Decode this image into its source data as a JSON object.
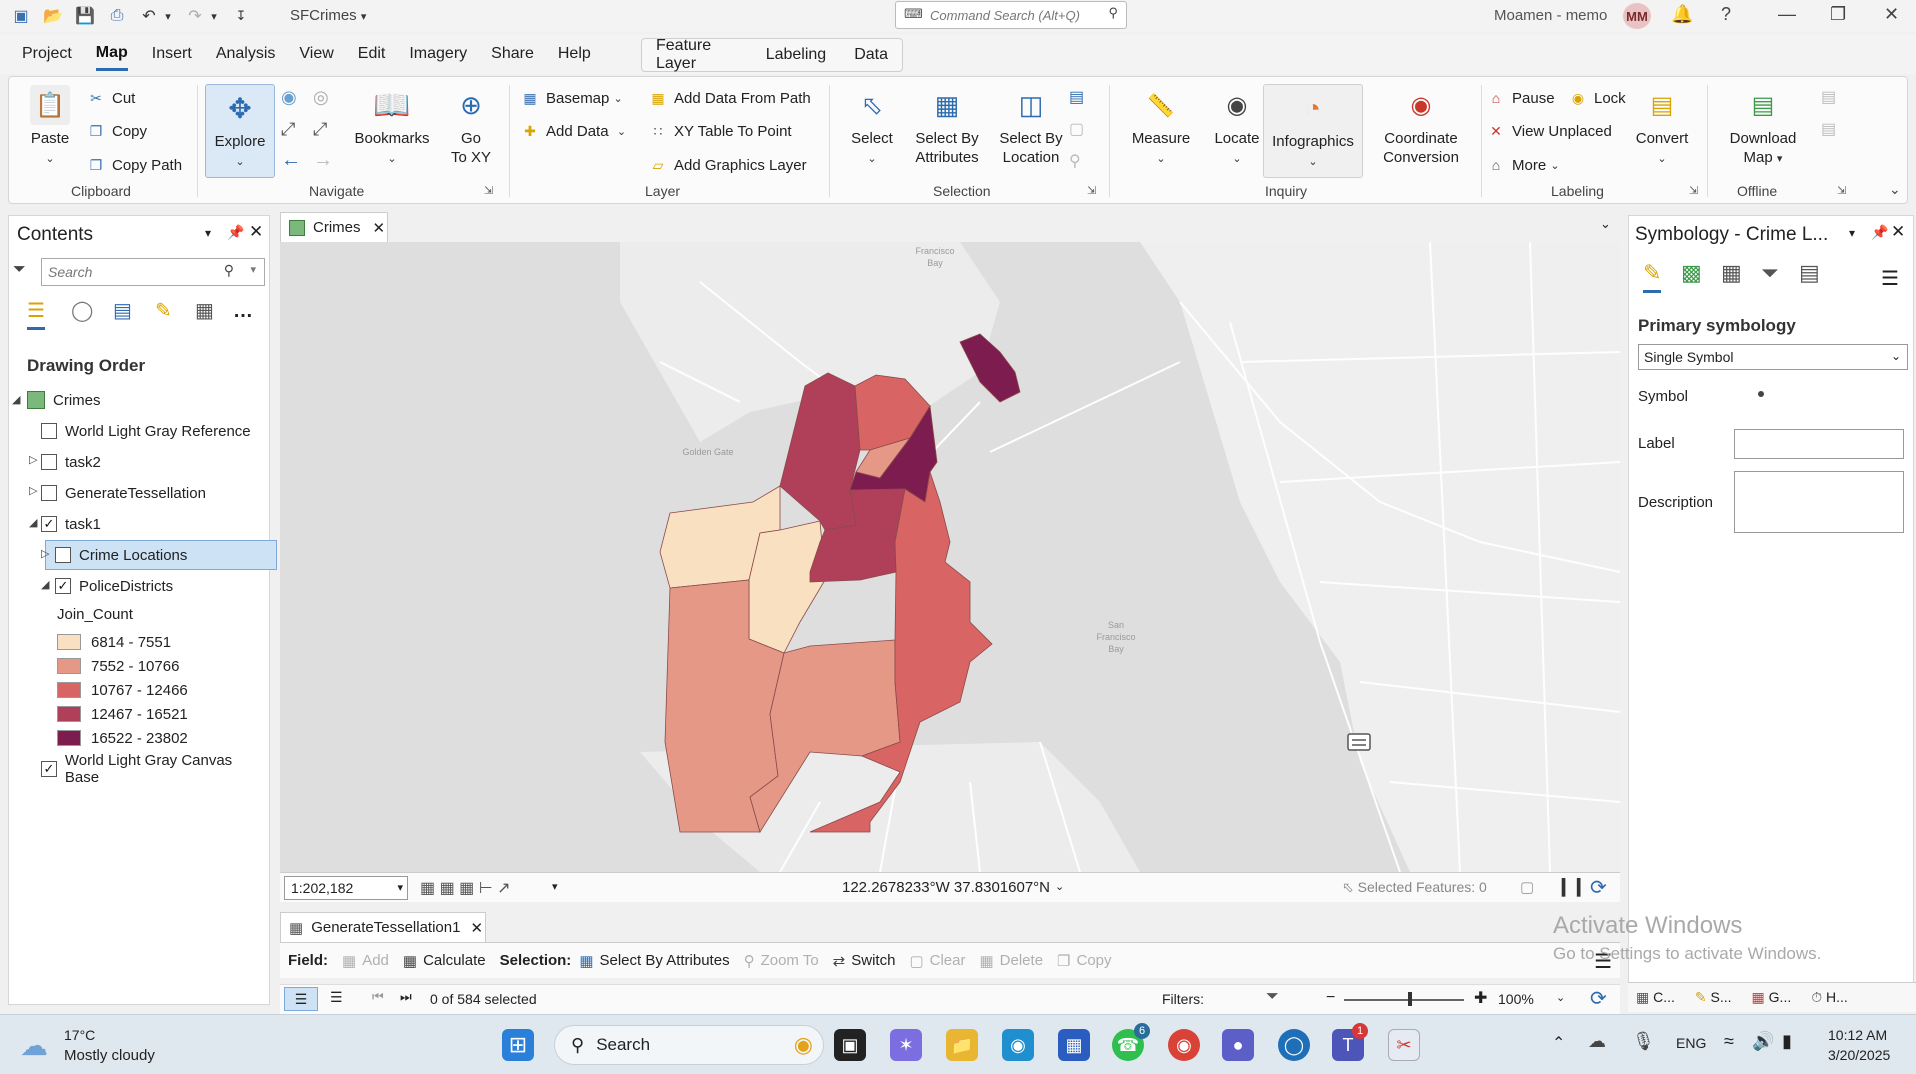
{
  "titlebar": {
    "app_title": "SFCrimes",
    "command_search_placeholder": "Command Search (Alt+Q)",
    "user_name": "Moamen - memo",
    "user_initials": "MM"
  },
  "menu": {
    "items": [
      "Project",
      "Map",
      "Insert",
      "Analysis",
      "View",
      "Edit",
      "Imagery",
      "Share",
      "Help"
    ],
    "active": "Map",
    "contextual_tabs": [
      "Feature Layer",
      "Labeling",
      "Data"
    ]
  },
  "ribbon": {
    "clipboard": {
      "paste": "Paste",
      "cut": "Cut",
      "copy": "Copy",
      "copy_path": "Copy Path",
      "group": "Clipboard"
    },
    "navigate": {
      "explore": "Explore",
      "bookmarks": "Bookmarks",
      "go_to_xy_1": "Go",
      "go_to_xy_2": "To XY",
      "group": "Navigate"
    },
    "layer": {
      "basemap": "Basemap",
      "add_data": "Add Data",
      "add_data_from_path": "Add Data From Path",
      "xy_table_to_point": "XY Table To Point",
      "add_graphics_layer": "Add Graphics Layer",
      "group": "Layer"
    },
    "selection": {
      "select": "Select",
      "select_by_attributes_1": "Select By",
      "select_by_attributes_2": "Attributes",
      "select_by_location_1": "Select By",
      "select_by_location_2": "Location",
      "group": "Selection"
    },
    "inquiry": {
      "measure": "Measure",
      "locate": "Locate",
      "infographics": "Infographics",
      "coord_1": "Coordinate",
      "coord_2": "Conversion",
      "group": "Inquiry"
    },
    "labeling": {
      "pause": "Pause",
      "lock": "Lock",
      "view_unplaced": "View Unplaced",
      "more": "More",
      "convert": "Convert",
      "group": "Labeling"
    },
    "offline": {
      "download_1": "Download",
      "download_2": "Map",
      "group": "Offline"
    }
  },
  "contents": {
    "title": "Contents",
    "search_placeholder": "Search",
    "drawing_order": "Drawing Order",
    "map_name": "Crimes",
    "layers": [
      {
        "label": "World Light Gray Reference",
        "checked": false
      },
      {
        "label": "task2",
        "checked": false
      },
      {
        "label": "GenerateTessellation",
        "checked": false
      },
      {
        "label": "task1",
        "checked": true
      },
      {
        "label": "Crime Locations",
        "checked": false
      },
      {
        "label": "PoliceDistricts",
        "checked": true
      },
      {
        "label": "World Light Gray Canvas Base",
        "checked": true
      }
    ],
    "legend_field": "Join_Count",
    "legend": [
      {
        "label": "6814 - 7551",
        "color": "#f9e0c0"
      },
      {
        "label": "7552 - 10766",
        "color": "#e69887"
      },
      {
        "label": "10767 - 12466",
        "color": "#d86464"
      },
      {
        "label": "12467 - 16521",
        "color": "#b0405a"
      },
      {
        "label": "16522 - 23802",
        "color": "#7d1c4e"
      }
    ]
  },
  "map": {
    "tab": "Crimes",
    "labels": {
      "francisco_1": "Francisco",
      "francisco_2": "Bay",
      "golden_gate": "Golden Gate",
      "sf_bay_1": "San",
      "sf_bay_2": "Francisco",
      "sf_bay_3": "Bay"
    },
    "scale": "1:202,182",
    "coordinates": "122.2678233°W 37.8301607°N",
    "selected_features": "Selected Features: 0"
  },
  "attribute_table": {
    "tab": "GenerateTessellation1",
    "field_label": "Field:",
    "add": "Add",
    "calculate": "Calculate",
    "selection_label": "Selection:",
    "select_by_attributes": "Select By Attributes",
    "zoom_to": "Zoom To",
    "switch": "Switch",
    "clear": "Clear",
    "delete": "Delete",
    "copy": "Copy",
    "selected_count": "0 of 584 selected",
    "filters": "Filters:",
    "zoom": "100%"
  },
  "symbology": {
    "title": "Symbology - Crime L...",
    "primary_symbology": "Primary symbology",
    "mode": "Single Symbol",
    "symbol": "Symbol",
    "label": "Label",
    "description": "Description"
  },
  "bottom_tabs": [
    "C...",
    "S...",
    "G...",
    "H..."
  ],
  "watermark": {
    "line1": "Activate Windows",
    "line2": "Go to Settings to activate Windows."
  },
  "taskbar": {
    "temp": "17°C",
    "weather": "Mostly cloudy",
    "search": "Search",
    "lang": "ENG",
    "time": "10:12 AM",
    "date": "3/20/2025",
    "whatsapp_badge": "6",
    "teams_badge": "1"
  }
}
